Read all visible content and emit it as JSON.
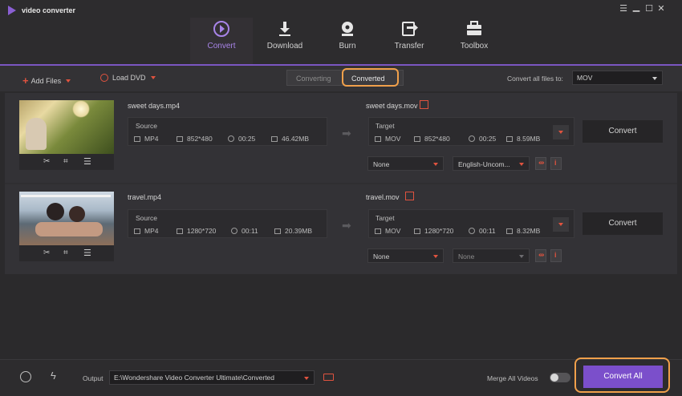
{
  "app": {
    "title": "video converter"
  },
  "nav": {
    "tabs": [
      {
        "label": "Convert",
        "icon": "convert-icon",
        "active": true
      },
      {
        "label": "Download",
        "icon": "download-icon"
      },
      {
        "label": "Burn",
        "icon": "burn-icon"
      },
      {
        "label": "Transfer",
        "icon": "transfer-icon"
      },
      {
        "label": "Toolbox",
        "icon": "toolbox-icon"
      }
    ]
  },
  "toolbar": {
    "add_files": "Add Files",
    "load_dvd": "Load DVD",
    "tab_converting": "Converting",
    "tab_converted": "Converted",
    "convert_all_label": "Convert all files to:",
    "format": "MOV"
  },
  "items": [
    {
      "source_name": "sweet days.mp4",
      "source_label": "Source",
      "source_format": "MP4",
      "source_resolution": "852*480",
      "source_duration": "00:25",
      "source_size": "46.42MB",
      "target_name": "sweet days.mov",
      "target_label": "Target",
      "target_format": "MOV",
      "target_resolution": "852*480",
      "target_duration": "00:25",
      "target_size": "8.59MB",
      "subtitle": "None",
      "audio": "English-Uncom...",
      "convert_label": "Convert"
    },
    {
      "source_name": "travel.mp4",
      "source_label": "Source",
      "source_format": "MP4",
      "source_resolution": "1280*720",
      "source_duration": "00:11",
      "source_size": "20.39MB",
      "target_name": "travel.mov",
      "target_label": "Target",
      "target_format": "MOV",
      "target_resolution": "1280*720",
      "target_duration": "00:11",
      "target_size": "8.32MB",
      "subtitle": "None",
      "audio": "None",
      "convert_label": "Convert"
    }
  ],
  "footer": {
    "output_label": "Output",
    "output_path": "E:\\Wondershare Video Converter Ultimate\\Converted",
    "merge_label": "Merge All Videos",
    "merge_on": false,
    "convert_all": "Convert All"
  },
  "colors": {
    "accent": "#7b4fcb",
    "highlight": "#f0a04b",
    "warn": "#e0533f"
  }
}
